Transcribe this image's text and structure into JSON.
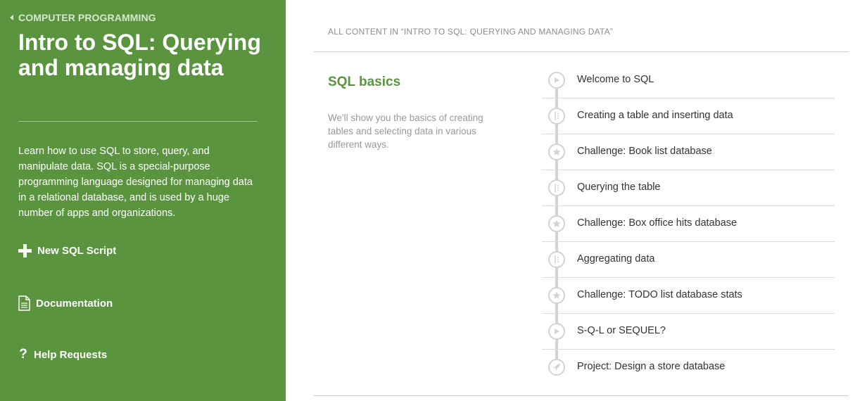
{
  "sidebar": {
    "breadcrumb": "COMPUTER PROGRAMMING",
    "title": "Intro to SQL: Querying and managing data",
    "description": "Learn how to use SQL to store, query, and manipulate data. SQL is a special-purpose programming language designed for managing data in a relational database, and is used by a huge number of apps and organizations.",
    "links": {
      "new_script": {
        "label": "New SQL Script",
        "icon": "plus-icon"
      },
      "documentation": {
        "label": "Documentation",
        "icon": "document-icon"
      },
      "help": {
        "label": "Help Requests",
        "icon": "question-icon"
      }
    },
    "background_color": "#5a943f"
  },
  "main": {
    "header": "ALL CONTENT IN “INTRO TO SQL: QUERYING AND MANAGING DATA”",
    "section": {
      "title": "SQL basics",
      "description": "We'll show you the basics of creating tables and selecting data in various different ways."
    },
    "items": [
      {
        "label": "Welcome to SQL",
        "icon": "video-play-icon"
      },
      {
        "label": "Creating a table and inserting data",
        "icon": "talkthrough-icon"
      },
      {
        "label": "Challenge: Book list database",
        "icon": "challenge-star-icon"
      },
      {
        "label": "Querying the table",
        "icon": "talkthrough-icon"
      },
      {
        "label": "Challenge: Box office hits database",
        "icon": "challenge-star-icon"
      },
      {
        "label": "Aggregating data",
        "icon": "talkthrough-icon"
      },
      {
        "label": "Challenge: TODO list database stats",
        "icon": "challenge-star-icon"
      },
      {
        "label": "S-Q-L or SEQUEL?",
        "icon": "video-play-icon"
      },
      {
        "label": "Project: Design a store database",
        "icon": "project-rocket-icon"
      }
    ]
  }
}
